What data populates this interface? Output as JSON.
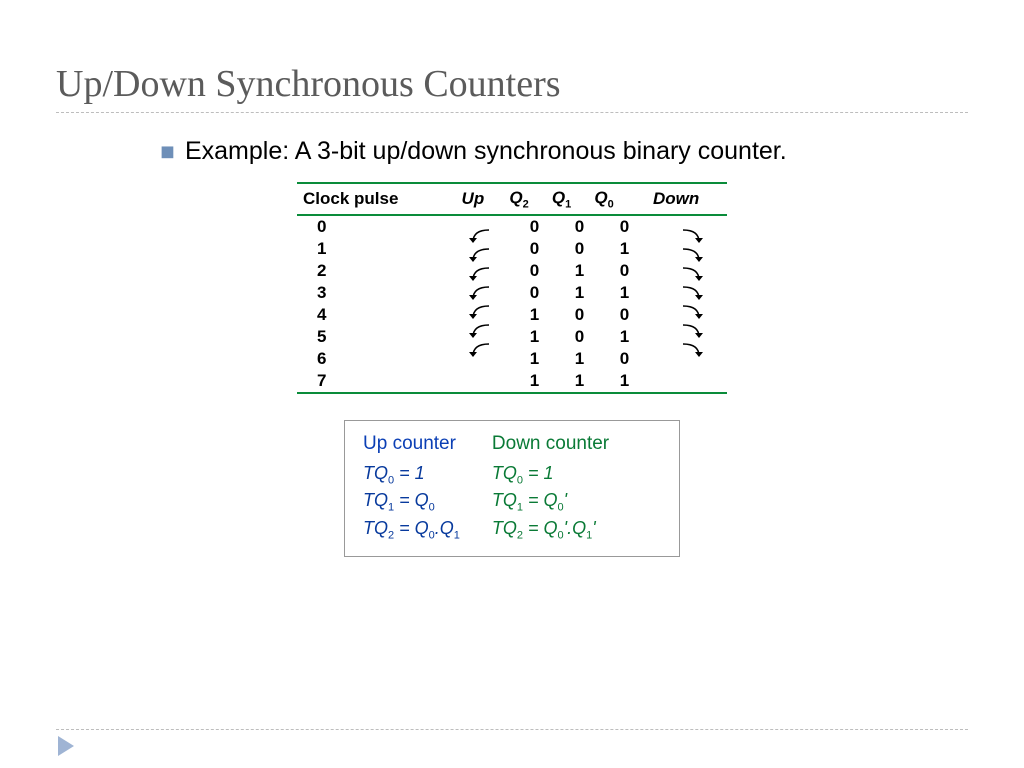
{
  "title": "Up/Down Synchronous Counters",
  "bullet": "Example: A 3-bit up/down synchronous binary counter.",
  "table": {
    "headers": {
      "clock": "Clock pulse",
      "up": "Up",
      "q2": "Q",
      "q2sub": "2",
      "q1": "Q",
      "q1sub": "1",
      "q0": "Q",
      "q0sub": "0",
      "down": "Down"
    },
    "rows": [
      {
        "cp": "0",
        "q2": "0",
        "q1": "0",
        "q0": "0"
      },
      {
        "cp": "1",
        "q2": "0",
        "q1": "0",
        "q0": "1"
      },
      {
        "cp": "2",
        "q2": "0",
        "q1": "1",
        "q0": "0"
      },
      {
        "cp": "3",
        "q2": "0",
        "q1": "1",
        "q0": "1"
      },
      {
        "cp": "4",
        "q2": "1",
        "q1": "0",
        "q0": "0"
      },
      {
        "cp": "5",
        "q2": "1",
        "q1": "0",
        "q0": "1"
      },
      {
        "cp": "6",
        "q2": "1",
        "q1": "1",
        "q0": "0"
      },
      {
        "cp": "7",
        "q2": "1",
        "q1": "1",
        "q0": "1"
      }
    ]
  },
  "equations": {
    "up": {
      "heading": "Up counter",
      "e0var": "TQ",
      "e0sub": "0",
      "e0rhs": " = 1",
      "e1var": "TQ",
      "e1sub": "1",
      "e1rhs": " = Q",
      "e1rhssub": "0",
      "e2var": "TQ",
      "e2sub": "2",
      "e2rhs": " = Q",
      "e2rhssub1": "0",
      "e2dot": ".Q",
      "e2rhssub2": "1"
    },
    "down": {
      "heading": "Down counter",
      "e0var": "TQ",
      "e0sub": "0",
      "e0rhs": " = 1",
      "e1var": "TQ",
      "e1sub": "1",
      "e1rhs": " = Q",
      "e1rhssub": "0",
      "e1prime": "'",
      "e2var": "TQ",
      "e2sub": "2",
      "e2rhs": " = Q",
      "e2rhssub1": "0",
      "e2prime1": "'",
      "e2dot": ".Q",
      "e2rhssub2": "1",
      "e2prime2": "'"
    }
  }
}
